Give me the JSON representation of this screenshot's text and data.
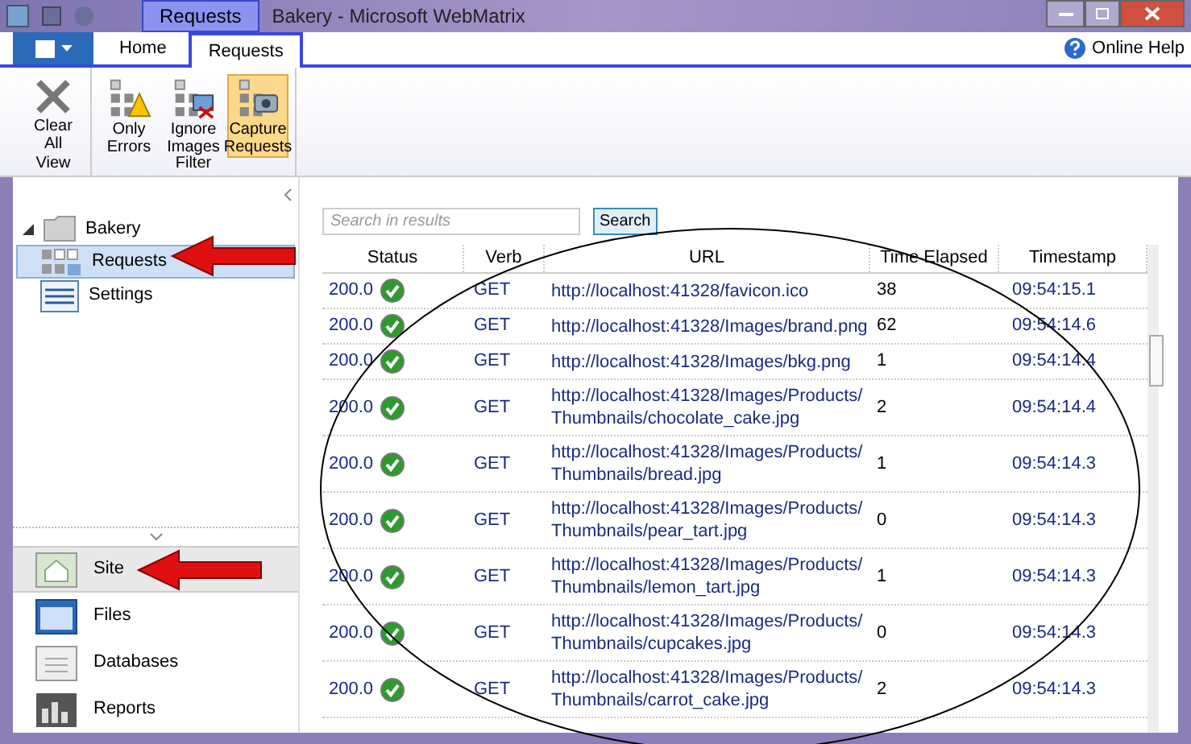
{
  "window": {
    "title": "Bakery - Microsoft WebMatrix",
    "contextual_tab": "Requests"
  },
  "ribbon_tabs": [
    {
      "label": "Home",
      "selected": false
    },
    {
      "label": "Requests",
      "selected": true
    }
  ],
  "online_help": "Online Help",
  "ribbon_groups": [
    {
      "label": "View",
      "buttons": [
        {
          "label": "Clear All",
          "kind": "clear",
          "selected": false
        }
      ]
    },
    {
      "label": "Filter",
      "buttons": [
        {
          "label": "Only Errors",
          "kind": "errors",
          "selected": false
        },
        {
          "label": "Ignore Images",
          "kind": "images",
          "selected": false
        },
        {
          "label": "Capture Requests",
          "kind": "capture",
          "selected": true
        }
      ]
    }
  ],
  "sidebar": {
    "items": [
      {
        "label": "Bakery",
        "kind": "folder",
        "expanded": true,
        "selected": false,
        "children": [
          {
            "label": "Requests",
            "kind": "requests",
            "selected": true
          },
          {
            "label": "Settings",
            "kind": "settings",
            "selected": false
          }
        ]
      }
    ]
  },
  "workspaces": [
    {
      "label": "Site",
      "kind": "site",
      "selected": true
    },
    {
      "label": "Files",
      "kind": "files",
      "selected": false
    },
    {
      "label": "Databases",
      "kind": "databases",
      "selected": false
    },
    {
      "label": "Reports",
      "kind": "reports",
      "selected": false
    }
  ],
  "search": {
    "placeholder": "Search in results",
    "button": "Search"
  },
  "table": {
    "columns": [
      "Status",
      "Verb",
      "URL",
      "Time Elapsed",
      "Timestamp"
    ],
    "rows": [
      {
        "status": "200.0",
        "verb": "GET",
        "url": [
          "http://localhost:41328/favicon.ico"
        ],
        "time": "38",
        "timestamp": "09:54:15.1"
      },
      {
        "status": "200.0",
        "verb": "GET",
        "url": [
          "http://localhost:41328/Images/brand.png"
        ],
        "time": "62",
        "timestamp": "09:54:14.6"
      },
      {
        "status": "200.0",
        "verb": "GET",
        "url": [
          "http://localhost:41328/Images/bkg.png"
        ],
        "time": "1",
        "timestamp": "09:54:14.4"
      },
      {
        "status": "200.0",
        "verb": "GET",
        "url": [
          "http://localhost:41328/Images/Products/",
          "Thumbnails/chocolate_cake.jpg"
        ],
        "time": "2",
        "timestamp": "09:54:14.4"
      },
      {
        "status": "200.0",
        "verb": "GET",
        "url": [
          "http://localhost:41328/Images/Products/",
          "Thumbnails/bread.jpg"
        ],
        "time": "1",
        "timestamp": "09:54:14.3"
      },
      {
        "status": "200.0",
        "verb": "GET",
        "url": [
          "http://localhost:41328/Images/Products/",
          "Thumbnails/pear_tart.jpg"
        ],
        "time": "0",
        "timestamp": "09:54:14.3"
      },
      {
        "status": "200.0",
        "verb": "GET",
        "url": [
          "http://localhost:41328/Images/Products/",
          "Thumbnails/lemon_tart.jpg"
        ],
        "time": "1",
        "timestamp": "09:54:14.3"
      },
      {
        "status": "200.0",
        "verb": "GET",
        "url": [
          "http://localhost:41328/Images/Products/",
          "Thumbnails/cupcakes.jpg"
        ],
        "time": "0",
        "timestamp": "09:54:14.3"
      },
      {
        "status": "200.0",
        "verb": "GET",
        "url": [
          "http://localhost:41328/Images/Products/",
          "Thumbnails/carrot_cake.jpg"
        ],
        "time": "2",
        "timestamp": "09:54:14.3"
      }
    ]
  }
}
